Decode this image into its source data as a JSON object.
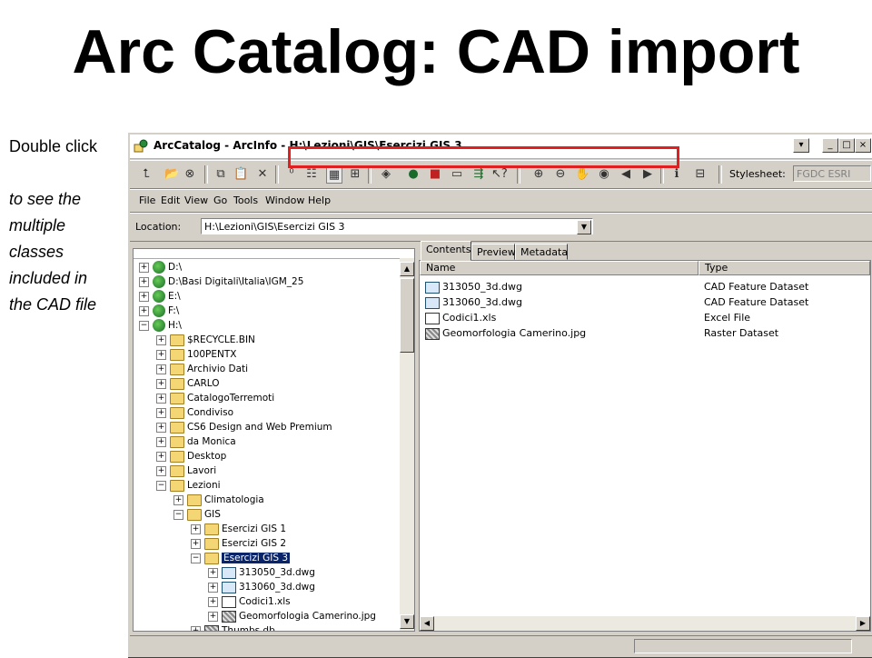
{
  "slide": {
    "title": "Arc Catalog: CAD import",
    "note_lines": [
      "Double click",
      "",
      "to see the",
      "multiple",
      "classes",
      "included in",
      "the CAD file"
    ]
  },
  "window": {
    "title": "ArcCatalog - ArcInfo - H:\\Lezioni\\GIS\\Esercizi GIS 3",
    "controls": {
      "dropdown": "▾",
      "minimize": "_",
      "maximize": "□",
      "close": "×"
    }
  },
  "toolbar": {
    "stylesheet_label": "Stylesheet:",
    "stylesheet_value": "FGDC ESRI",
    "icons": [
      "up-one-level-icon",
      "connect-folder-icon",
      "disconnect-folder-icon",
      "copy-icon",
      "paste-icon",
      "delete-icon",
      "large-icons-icon",
      "list-icon",
      "details-icon",
      "thumbnails-icon",
      "launch-arcmap-icon",
      "catalog-tree-icon",
      "arctoolbox-icon",
      "full-screen-icon",
      "metadata-icon",
      "whats-this-icon",
      "zoom-in-icon",
      "zoom-out-icon",
      "pan-icon",
      "full-extent-icon",
      "back-icon",
      "forward-icon",
      "identify-icon",
      "create-thumbnail-icon"
    ]
  },
  "menu": [
    "File",
    "Edit",
    "View",
    "Go",
    "Tools",
    "Window",
    "Help"
  ],
  "location": {
    "label": "Location:",
    "value": "H:\\Lezioni\\GIS\\Esercizi GIS 3"
  },
  "tree": [
    {
      "label": "D:\\",
      "depth": 0,
      "icon": "drive",
      "exp": "+"
    },
    {
      "label": "D:\\Basi Digitali\\Italia\\IGM_25",
      "depth": 0,
      "icon": "drive",
      "exp": "+"
    },
    {
      "label": "E:\\",
      "depth": 0,
      "icon": "drive",
      "exp": "+"
    },
    {
      "label": "F:\\",
      "depth": 0,
      "icon": "drive",
      "exp": "+"
    },
    {
      "label": "H:\\",
      "depth": 0,
      "icon": "drive",
      "exp": "−"
    },
    {
      "label": "$RECYCLE.BIN",
      "depth": 1,
      "icon": "folder",
      "exp": "+"
    },
    {
      "label": "100PENTX",
      "depth": 1,
      "icon": "folder",
      "exp": "+"
    },
    {
      "label": "Archivio Dati",
      "depth": 1,
      "icon": "folder",
      "exp": "+"
    },
    {
      "label": "CARLO",
      "depth": 1,
      "icon": "folder",
      "exp": "+"
    },
    {
      "label": "CatalogoTerremoti",
      "depth": 1,
      "icon": "folder",
      "exp": "+"
    },
    {
      "label": "Condiviso",
      "depth": 1,
      "icon": "folder",
      "exp": "+"
    },
    {
      "label": "CS6 Design and Web Premium",
      "depth": 1,
      "icon": "folder",
      "exp": "+"
    },
    {
      "label": "da Monica",
      "depth": 1,
      "icon": "folder",
      "exp": "+"
    },
    {
      "label": "Desktop",
      "depth": 1,
      "icon": "folder",
      "exp": "+"
    },
    {
      "label": "Lavori",
      "depth": 1,
      "icon": "folder",
      "exp": "+"
    },
    {
      "label": "Lezioni",
      "depth": 1,
      "icon": "folder",
      "exp": "−"
    },
    {
      "label": "Climatologia",
      "depth": 2,
      "icon": "folder",
      "exp": "+"
    },
    {
      "label": "GIS",
      "depth": 2,
      "icon": "folder",
      "exp": "−"
    },
    {
      "label": "Esercizi GIS 1",
      "depth": 3,
      "icon": "folder",
      "exp": "+"
    },
    {
      "label": "Esercizi GIS 2",
      "depth": 3,
      "icon": "folder",
      "exp": "+"
    },
    {
      "label": "Esercizi GIS 3",
      "depth": 3,
      "icon": "folder",
      "exp": "−",
      "selected": true
    },
    {
      "label": "313050_3d.dwg",
      "depth": 4,
      "icon": "cad",
      "exp": "+"
    },
    {
      "label": "313060_3d.dwg",
      "depth": 4,
      "icon": "cad",
      "exp": "+"
    },
    {
      "label": "Codici1.xls",
      "depth": 4,
      "icon": "xls",
      "exp": "+"
    },
    {
      "label": "Geomorfologia Camerino.jpg",
      "depth": 4,
      "icon": "jpg",
      "exp": "+"
    },
    {
      "label": "Thumbs.db",
      "depth": 3,
      "icon": "jpg",
      "exp": "+"
    }
  ],
  "tabs": [
    "Contents",
    "Preview",
    "Metadata"
  ],
  "columns": {
    "name": "Name",
    "type": "Type"
  },
  "contents": [
    {
      "name": "313050_3d.dwg",
      "type": "CAD Feature Dataset",
      "icon": "cad"
    },
    {
      "name": "313060_3d.dwg",
      "type": "CAD Feature Dataset",
      "icon": "cad"
    },
    {
      "name": "Codici1.xls",
      "type": "Excel File",
      "icon": "xls"
    },
    {
      "name": "Geomorfologia Camerino.jpg",
      "type": "Raster Dataset",
      "icon": "jpg"
    }
  ],
  "colors": {
    "highlight": "#e02020",
    "selection": "#0a246a"
  }
}
